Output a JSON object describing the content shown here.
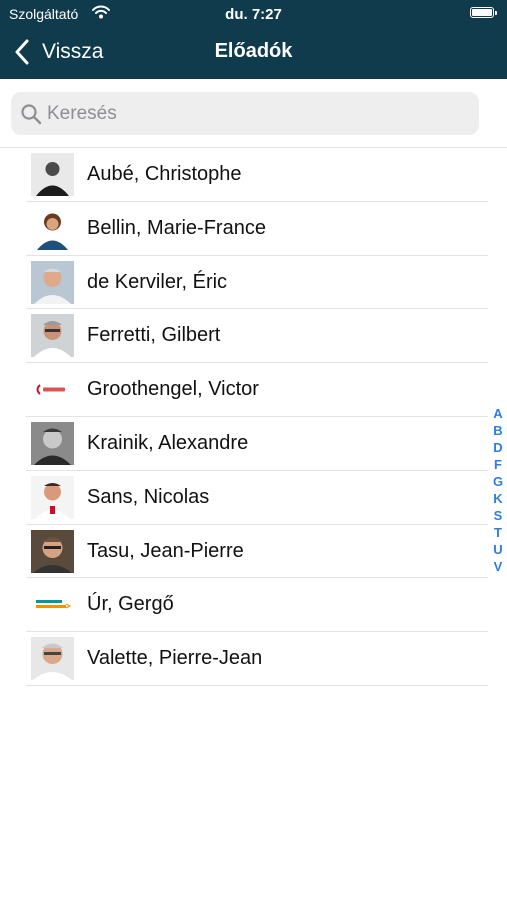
{
  "status_bar": {
    "carrier": "Szolgáltató",
    "time": "du. 7:27"
  },
  "nav": {
    "back_label": "Vissza",
    "title": "Előadók"
  },
  "search": {
    "placeholder": "Keresés",
    "value": ""
  },
  "speakers": [
    {
      "name": "Aubé, Christophe",
      "thumb": "portrait-photo"
    },
    {
      "name": "Bellin, Marie-France",
      "thumb": "portrait-photo"
    },
    {
      "name": "de Kerviler, Éric",
      "thumb": "portrait-photo"
    },
    {
      "name": "Ferretti, Gilbert",
      "thumb": "portrait-photo"
    },
    {
      "name": "Groothengel, Victor",
      "thumb": "company-logo"
    },
    {
      "name": "Krainik, Alexandre",
      "thumb": "portrait-photo"
    },
    {
      "name": "Sans, Nicolas",
      "thumb": "portrait-photo"
    },
    {
      "name": "Tasu, Jean-Pierre",
      "thumb": "portrait-photo"
    },
    {
      "name": "Úr, Gergő",
      "thumb": "company-logo"
    },
    {
      "name": "Valette, Pierre-Jean",
      "thumb": "portrait-photo"
    }
  ],
  "section_index": [
    "A",
    "B",
    "D",
    "F",
    "G",
    "K",
    "S",
    "T",
    "U",
    "V"
  ],
  "colors": {
    "nav_background": "#0f3b4c",
    "index_accent": "#2f7de1"
  }
}
